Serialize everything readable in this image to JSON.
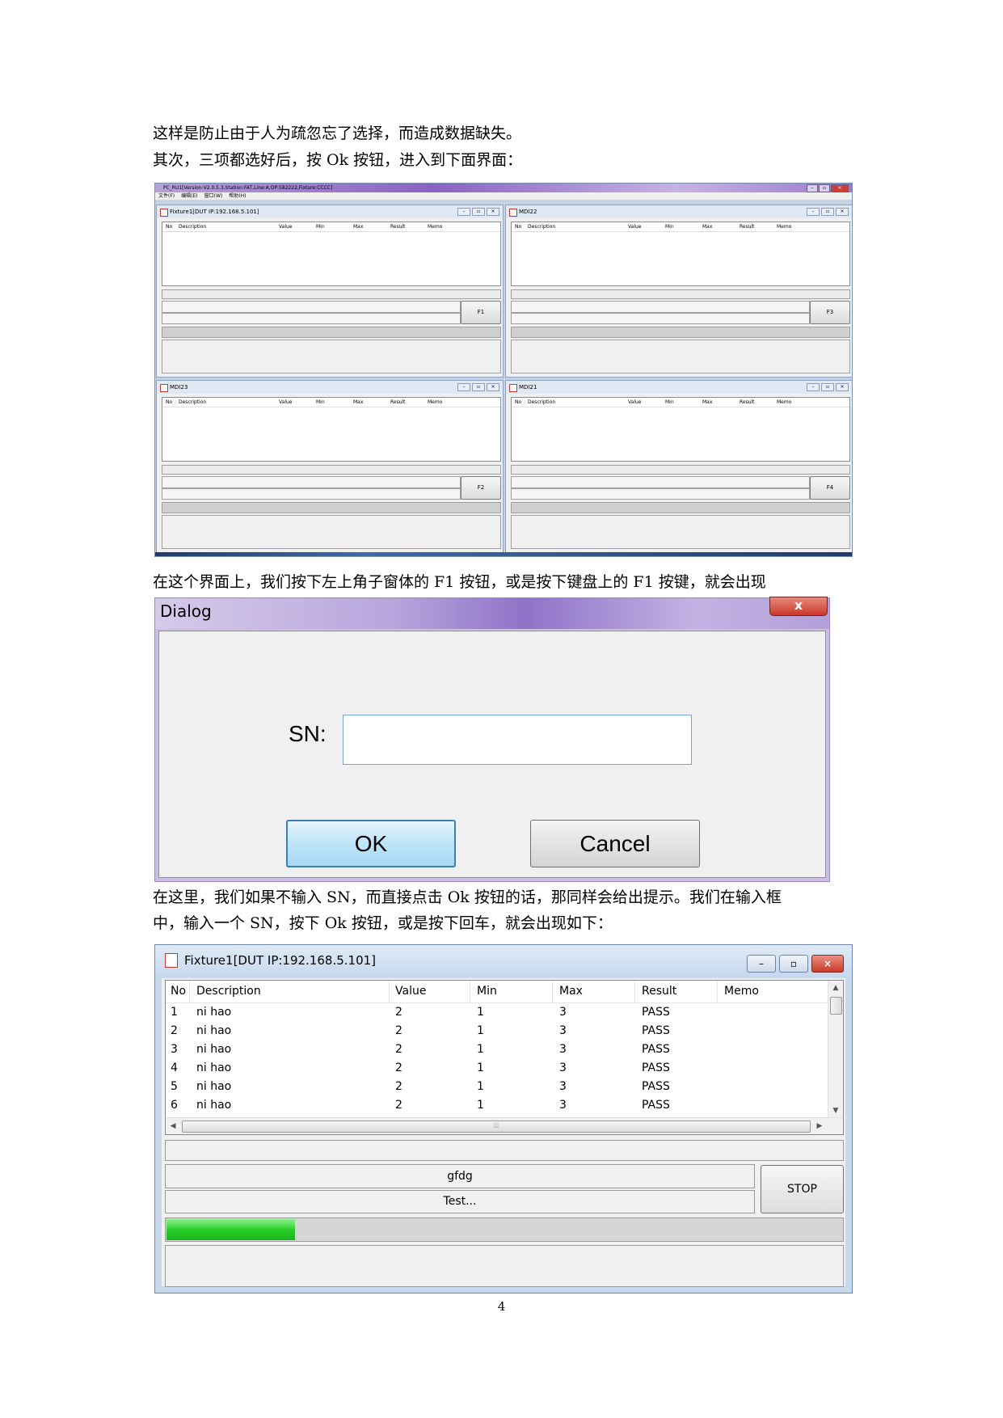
{
  "paragraphs": {
    "p1": "这样是防止由于人为疏忽忘了选择，而造成数据缺失。",
    "p2": "其次，三项都选好后，按 Ok 按钮，进入到下面界面：",
    "p3": "在这个界面上，我们按下左上角子窗体的 F1 按钮，或是按下键盘上的 F1 按键，就会出现",
    "p4": "在这里，我们如果不输入 SN，而直接点击 Ok 按钮的话，那同样会给出提示。我们在输入框",
    "p5": "中，输入一个 SN，按下 Ok 按钮，或是按下回车，就会出现如下："
  },
  "page_number": "4",
  "main_window": {
    "title": "PC_RU1[Version:V2.0.5.3,Station:FAT,Line:A,OP:582222,Fixture:CCCC]",
    "menu": [
      "文件(F)",
      "编辑(E)",
      "窗口(W)",
      "帮助(H)"
    ],
    "children": [
      {
        "title": "Fixture1[DUT IP:192.168.5.101]",
        "button": "F1"
      },
      {
        "title": "MDI22",
        "button": "F3"
      },
      {
        "title": "MDI23",
        "button": "F2"
      },
      {
        "title": "MDI21",
        "button": "F4"
      }
    ],
    "columns": [
      "No",
      "Description",
      "Value",
      "Min",
      "Max",
      "Result",
      "Memo"
    ]
  },
  "dialog": {
    "title": "Dialog",
    "close_label": "x",
    "sn_label": "SN:",
    "sn_value": "",
    "ok_label": "OK",
    "cancel_label": "Cancel"
  },
  "fixture_window": {
    "title": "Fixture1[DUT IP:192.168.5.101]",
    "columns": [
      "No",
      "Description",
      "Value",
      "Min",
      "Max",
      "Result",
      "Memo"
    ],
    "rows": [
      {
        "no": "1",
        "desc": "ni hao",
        "value": "2",
        "min": "1",
        "max": "3",
        "result": "PASS",
        "memo": ""
      },
      {
        "no": "2",
        "desc": "ni hao",
        "value": "2",
        "min": "1",
        "max": "3",
        "result": "PASS",
        "memo": ""
      },
      {
        "no": "3",
        "desc": "ni hao",
        "value": "2",
        "min": "1",
        "max": "3",
        "result": "PASS",
        "memo": ""
      },
      {
        "no": "4",
        "desc": "ni hao",
        "value": "2",
        "min": "1",
        "max": "3",
        "result": "PASS",
        "memo": ""
      },
      {
        "no": "5",
        "desc": "ni hao",
        "value": "2",
        "min": "1",
        "max": "3",
        "result": "PASS",
        "memo": ""
      },
      {
        "no": "6",
        "desc": "ni hao",
        "value": "2",
        "min": "1",
        "max": "3",
        "result": "PASS",
        "memo": ""
      }
    ],
    "message1": "gfdg",
    "message2": "Test...",
    "stop_label": "STOP",
    "progress_fraction": 0.19,
    "progress_color": "#2bcf2b"
  }
}
